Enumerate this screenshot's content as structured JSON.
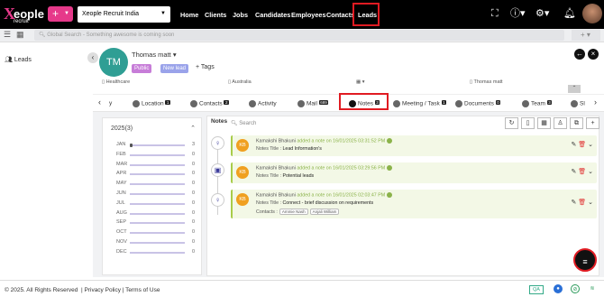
{
  "topbar": {
    "logo_main": "eople",
    "logo_x": "X",
    "logo_sub": "recruit",
    "add_label": "+",
    "company": "Xeople Recruit India",
    "nav": [
      "Home",
      "Clients",
      "Jobs",
      "Candidates",
      "Employees",
      "Contacts",
      "Leads"
    ],
    "active_nav": "Leads"
  },
  "search": {
    "placeholder": "Global Search - Something awesome is coming soon",
    "add_label": "+"
  },
  "sidebar": {
    "items": [
      {
        "label": "Leads"
      }
    ]
  },
  "lead": {
    "initials": "TM",
    "name": "Thomas matt",
    "badges": [
      "Public",
      "New lead"
    ],
    "tags_label": "+ Tags",
    "industry": "Healthcare",
    "location": "Australia",
    "owner": "Thomas matt"
  },
  "tabs": [
    {
      "label": "y",
      "count": ""
    },
    {
      "label": "Location",
      "count": "1"
    },
    {
      "label": "Contacts",
      "count": "2"
    },
    {
      "label": "Activity",
      "count": ""
    },
    {
      "label": "Mail",
      "count": "689"
    },
    {
      "label": "Notes",
      "count": "3"
    },
    {
      "label": "Meeting / Task",
      "count": "1"
    },
    {
      "label": "Documents",
      "count": "0"
    },
    {
      "label": "Team",
      "count": "3"
    },
    {
      "label": "Sl",
      "count": ""
    }
  ],
  "year_summary": {
    "year_label": "2025(3)",
    "months": [
      {
        "m": "JAN",
        "c": 3,
        "frac": 0.05
      },
      {
        "m": "FEB",
        "c": 0,
        "frac": 0
      },
      {
        "m": "MAR",
        "c": 0,
        "frac": 0
      },
      {
        "m": "APR",
        "c": 0,
        "frac": 0
      },
      {
        "m": "MAY",
        "c": 0,
        "frac": 0
      },
      {
        "m": "JUN",
        "c": 0,
        "frac": 0
      },
      {
        "m": "JUL",
        "c": 0,
        "frac": 0
      },
      {
        "m": "AUG",
        "c": 0,
        "frac": 0
      },
      {
        "m": "SEP",
        "c": 0,
        "frac": 0
      },
      {
        "m": "OCT",
        "c": 0,
        "frac": 0
      },
      {
        "m": "NOV",
        "c": 0,
        "frac": 0
      },
      {
        "m": "DEC",
        "c": 0,
        "frac": 0
      }
    ]
  },
  "notes_panel": {
    "title": "Notes",
    "search_placeholder": "Search"
  },
  "notes": [
    {
      "initials": "KB",
      "author": "Kamakshi Bhakuni",
      "action": "added a note on",
      "date": "16/01/2025 03:31:52 PM",
      "title_label": "Notes Title :",
      "title": "Lead Information's",
      "contacts_label": "",
      "contacts": []
    },
    {
      "initials": "KB",
      "author": "Kamakshi Bhakuni",
      "action": "added a note on",
      "date": "16/01/2025 03:29:56 PM",
      "title_label": "Notes Title :",
      "title": "Potential leads",
      "contacts_label": "",
      "contacts": []
    },
    {
      "initials": "KB",
      "author": "Kamakshi Bhakuni",
      "action": "added a note on",
      "date": "16/01/2025 02:03:47 PM",
      "title_label": "Notes Title :",
      "title": "Connect - brief discussion on requirements",
      "contacts_label": "Contacts :",
      "contacts": [
        "Ammie Nash",
        "Anjali William"
      ]
    }
  ],
  "footer": {
    "copyright": "© 2025. All Rights Reserved",
    "privacy": "Privacy Policy",
    "terms": "Terms of Use",
    "qa": "QA"
  },
  "colors": {
    "brand": "#e6398a",
    "highlight": "#e01b22",
    "avatar": "#2f9e94",
    "note_accent": "#a8cc4a"
  }
}
